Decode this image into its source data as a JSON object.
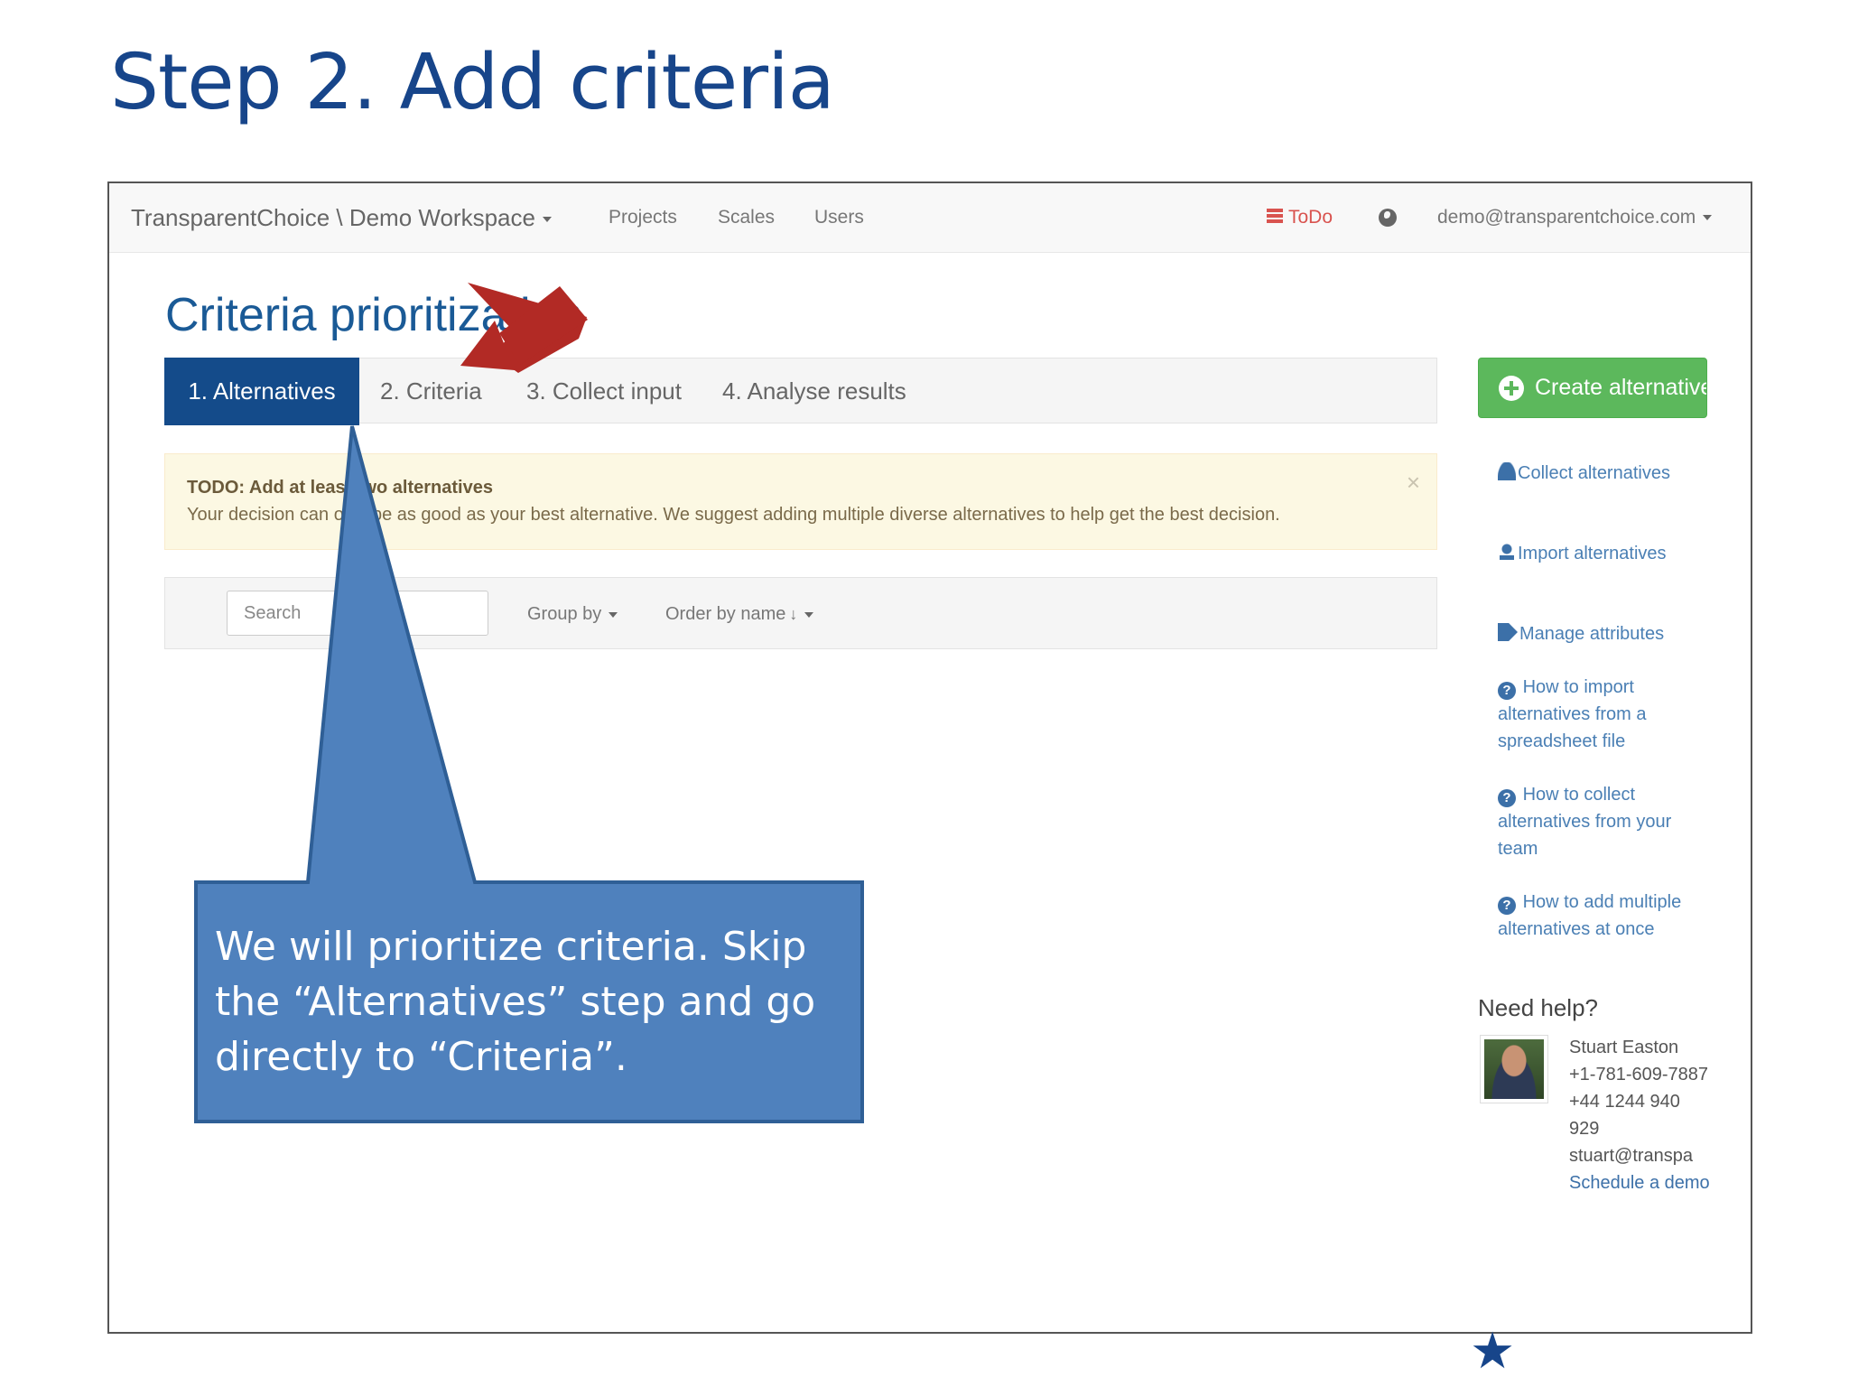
{
  "slide": {
    "title": "Step 2. Add criteria",
    "callout_text": "We will prioritize criteria. Skip the “Alternatives” step and go directly to “Criteria”."
  },
  "navbar": {
    "brand": "TransparentChoice \\ Demo Workspace",
    "links": [
      "Projects",
      "Scales",
      "Users"
    ],
    "todo": "ToDo",
    "account": "demo@transparentchoice.com"
  },
  "page": {
    "title": "Criteria prioritization",
    "tabs": [
      "1. Alternatives",
      "2. Criteria",
      "3. Collect input",
      "4. Analyse results"
    ],
    "active_tab": "1. Alternatives"
  },
  "alert": {
    "title": "TODO: Add at least two alternatives",
    "body": "Your decision can only be as good as your best alternative. We suggest adding multiple diverse alternatives to help get the best decision."
  },
  "filters": {
    "search_placeholder": "Search",
    "group_by": "Group by",
    "order_by": "Order by name"
  },
  "sidebar": {
    "create_button": "Create alternative",
    "links": [
      {
        "icon": "user-icon",
        "label": "Collect alternatives"
      },
      {
        "icon": "import-icon",
        "label": "Import alternatives"
      },
      {
        "icon": "tag-icon",
        "label": "Manage attributes"
      },
      {
        "icon": "question-circle-icon",
        "label": "How to import alternatives from a spreadsheet file"
      },
      {
        "icon": "question-circle-icon",
        "label": "How to collect alternatives from your team"
      },
      {
        "icon": "question-circle-icon",
        "label": "How to add multiple alternatives at once"
      }
    ],
    "help": {
      "title": "Need help?",
      "name": "Stuart Easton",
      "phone_us": "+1-781-609-7887",
      "phone_uk": "+44 1244 940 929",
      "email": "stuart@transpa",
      "schedule": "Schedule a demo"
    }
  },
  "colors": {
    "slide_title": "#17458a",
    "active_tab": "#144b8a",
    "create_button": "#5cb85c",
    "callout": "#4f81bd",
    "arrow": "#b22a25"
  }
}
